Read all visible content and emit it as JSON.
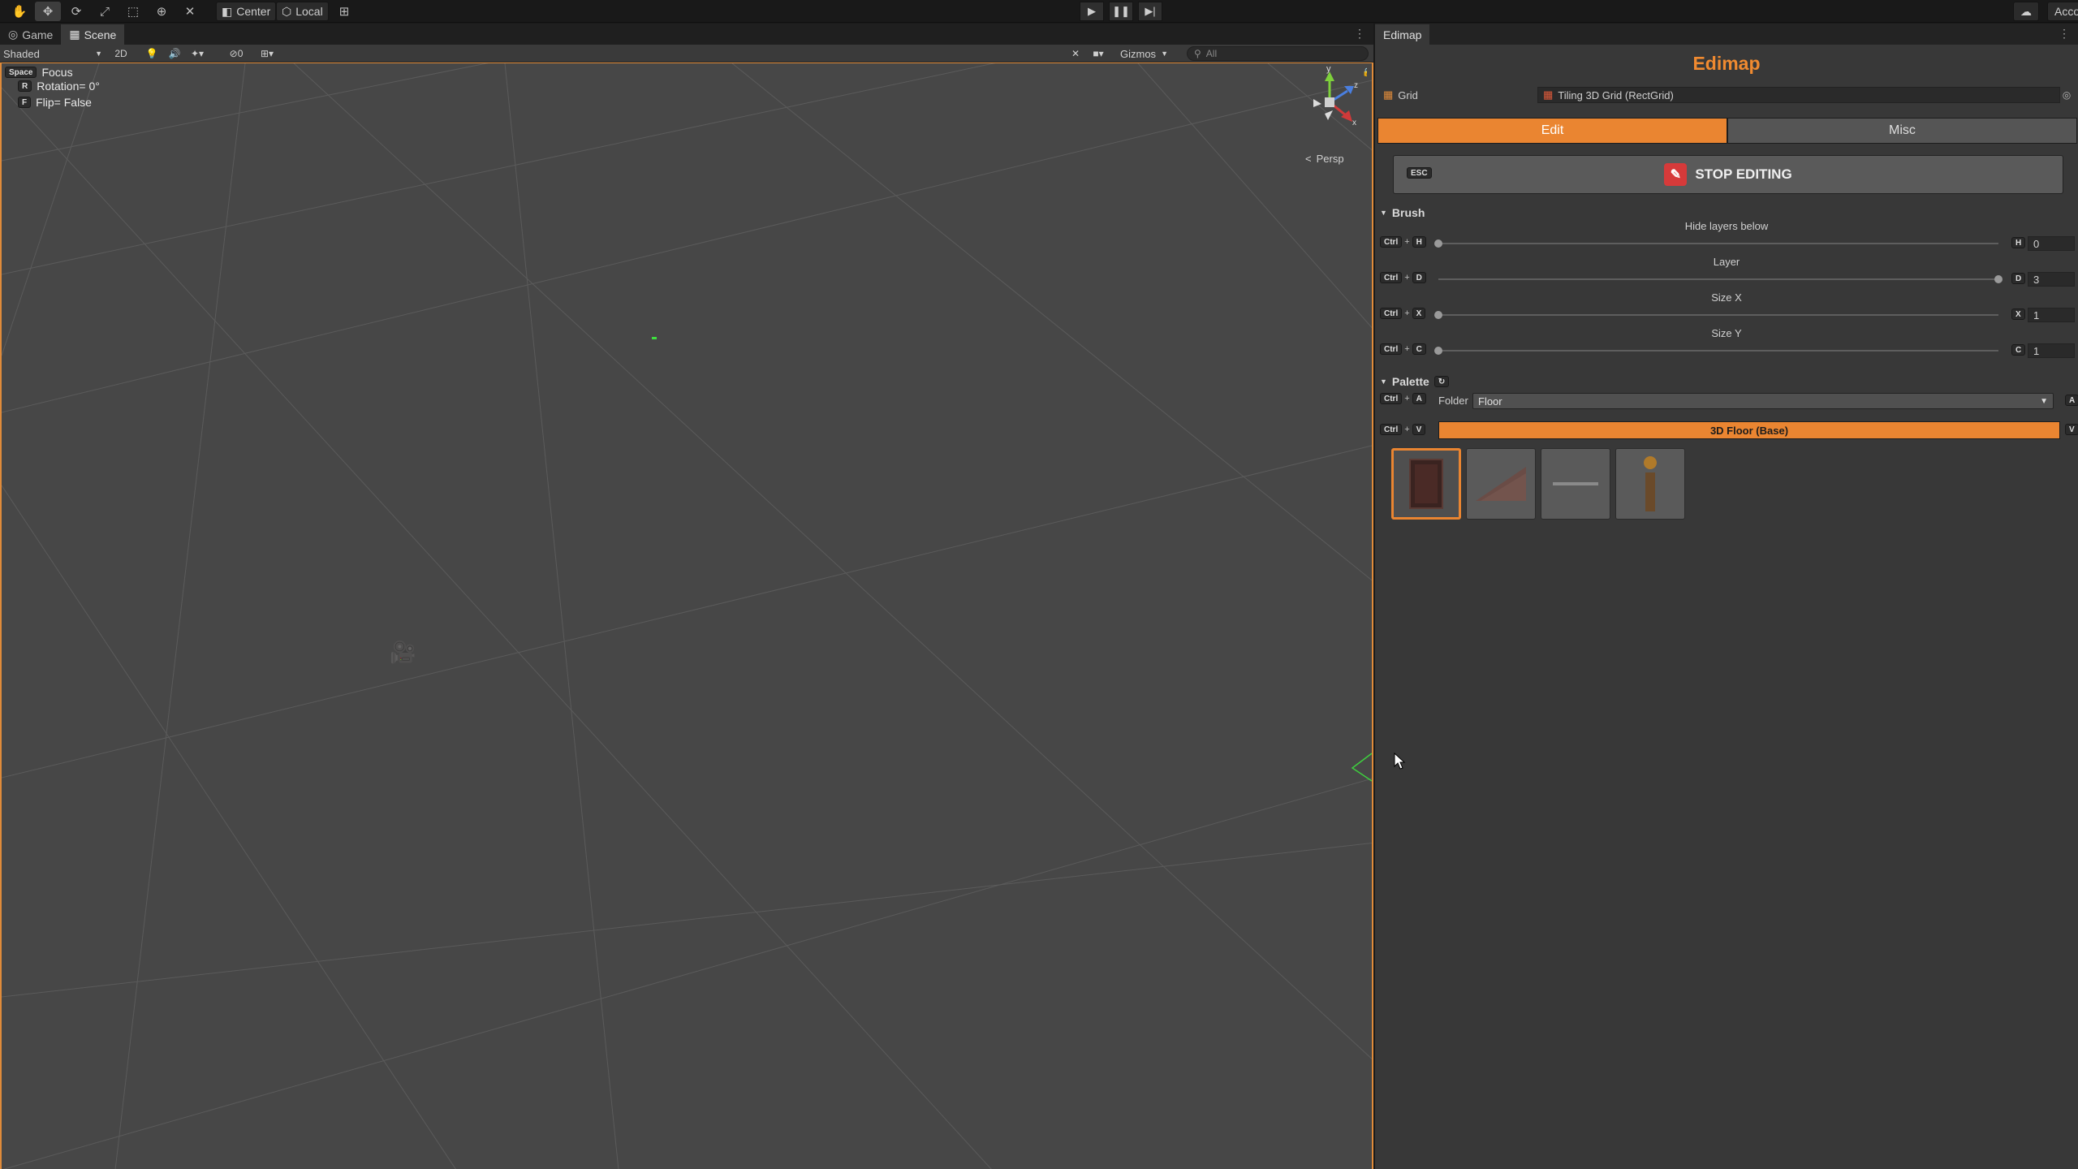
{
  "toolbar": {
    "tools": [
      {
        "name": "hand-tool",
        "glyph": "✋",
        "active": false
      },
      {
        "name": "move-tool",
        "glyph": "✥",
        "active": true
      },
      {
        "name": "rotate-tool",
        "glyph": "⟳",
        "active": false
      },
      {
        "name": "scale-tool",
        "glyph": "⤢",
        "active": false
      },
      {
        "name": "rect-tool",
        "glyph": "⬚",
        "active": false
      },
      {
        "name": "transform-tool",
        "glyph": "⊕",
        "active": false
      },
      {
        "name": "custom-tool",
        "glyph": "✕",
        "active": false
      }
    ],
    "pivot": "Center",
    "space": "Local",
    "right_label": "Acco"
  },
  "scene_panel": {
    "tabs": [
      {
        "label": "Game",
        "icon": "gamepad-icon",
        "active": false
      },
      {
        "label": "Scene",
        "icon": "scene-icon",
        "active": true
      }
    ],
    "shading_mode": "Shaded",
    "mode_2d": "2D",
    "hidden_count": "0",
    "gizmos_label": "Gizmos",
    "search_placeholder": "All",
    "overlays": [
      {
        "key": "Space",
        "text": "Focus"
      },
      {
        "key": "R",
        "text": "Rotation= 0°"
      },
      {
        "key": "F",
        "text": "Flip= False"
      }
    ],
    "gizmo_axes": {
      "y": "y",
      "z": "z",
      "x": "x"
    },
    "persp_label": "Persp"
  },
  "edimap": {
    "tab_label": "Edimap",
    "title": "Edimap",
    "grid_label": "Grid",
    "grid_value": "Tiling 3D Grid (RectGrid)",
    "mode_tabs": [
      {
        "label": "Edit",
        "active": true
      },
      {
        "label": "Misc",
        "active": false
      }
    ],
    "stop_button": {
      "key": "ESC",
      "label": "STOP EDITING"
    },
    "brush": {
      "section_label": "Brush",
      "sliders": [
        {
          "label": "Hide layers below",
          "key": "H",
          "value": "0",
          "fraction": 0.0
        },
        {
          "label": "Layer",
          "key": "D",
          "value": "3",
          "fraction": 1.0
        },
        {
          "label": "Size X",
          "key": "X",
          "value": "1",
          "fraction": 0.0
        },
        {
          "label": "Size Y",
          "key": "C",
          "value": "1",
          "fraction": 0.0
        }
      ]
    },
    "palette": {
      "section_label": "Palette",
      "folder_key": "A",
      "folder_label": "Folder",
      "folder_value": "Floor",
      "variant_key": "V",
      "variant_label": "3D Floor (Base)",
      "tiles": [
        {
          "name": "floor-tile-dark",
          "selected": true
        },
        {
          "name": "ramp-tile",
          "selected": false
        },
        {
          "name": "flat-tile",
          "selected": false
        },
        {
          "name": "pillar-tile",
          "selected": false
        }
      ]
    },
    "modifier_key": "Ctrl",
    "plus": "+"
  }
}
